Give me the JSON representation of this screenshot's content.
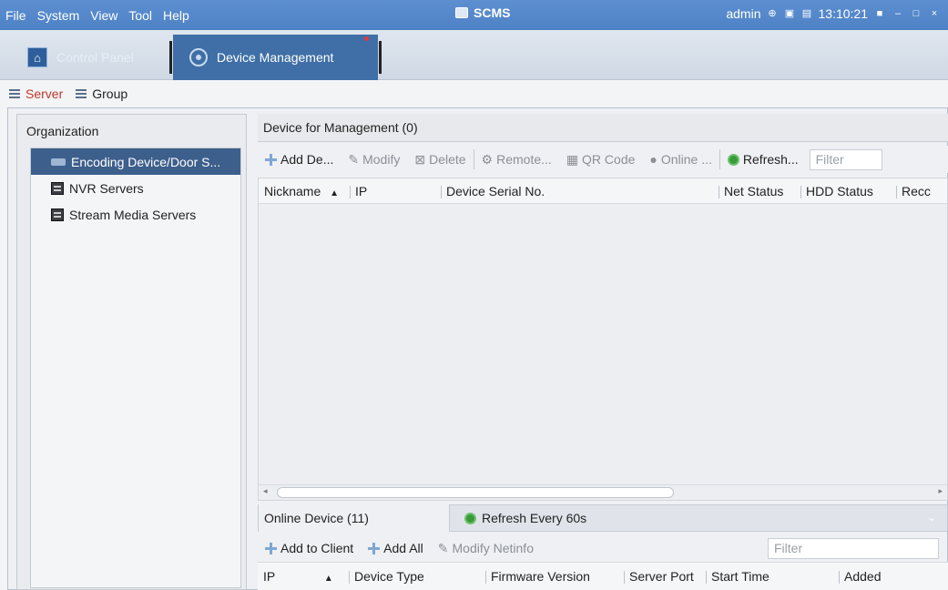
{
  "menu": [
    "File",
    "System",
    "View",
    "Tool",
    "Help"
  ],
  "app_title": "SCMS",
  "status": {
    "user": "admin",
    "time": "13:10:21"
  },
  "modules": {
    "control_panel": "Control Panel",
    "device_management": "Device Management"
  },
  "subtabs": {
    "server": "Server",
    "group": "Group"
  },
  "left": {
    "header": "Organization",
    "items": [
      "Encoding Device/Door S...",
      "NVR Servers",
      "Stream Media Servers"
    ]
  },
  "management": {
    "header": "Device for Management (0)",
    "toolbar": {
      "add": "Add De...",
      "modify": "Modify",
      "delete": "Delete",
      "remote": "Remote...",
      "qr": "QR Code",
      "online": "Online ...",
      "refresh": "Refresh...",
      "filter_placeholder": "Filter"
    },
    "columns": [
      "Nickname",
      "IP",
      "Device Serial No.",
      "Net Status",
      "HDD Status",
      "Recc"
    ]
  },
  "online": {
    "header": "Online Device (11)",
    "refresh": "Refresh Every 60s",
    "toolbar": {
      "add_to_client": "Add to Client",
      "add_all": "Add All",
      "modify_netinfo": "Modify Netinfo",
      "filter_placeholder": "Filter"
    },
    "columns": [
      "IP",
      "Device Type",
      "Firmware Version",
      "Server Port",
      "Start Time",
      "Added"
    ]
  }
}
